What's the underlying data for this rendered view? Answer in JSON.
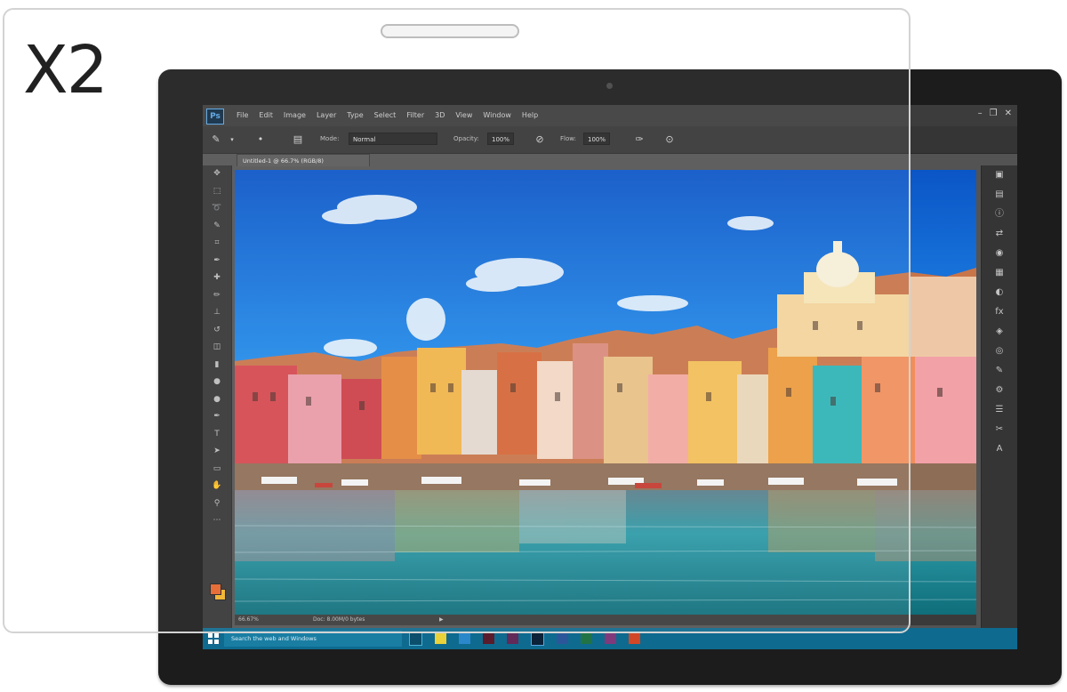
{
  "product": {
    "quantity_label": "X2"
  },
  "app": {
    "logo_text": "Ps",
    "menu": [
      "File",
      "Edit",
      "Image",
      "Layer",
      "Type",
      "Select",
      "Filter",
      "3D",
      "View",
      "Window",
      "Help"
    ],
    "options": {
      "mode_label": "Mode:",
      "mode_value": "Normal",
      "opacity_label": "Opacity:",
      "opacity_value": "100%",
      "flow_label": "Flow:",
      "flow_value": "100%"
    },
    "document_tab": "Untitled-1 @ 66.7% (RGB/8)",
    "status": {
      "zoom": "66.67%",
      "doc_info": "Doc: 8.00M/0 bytes"
    }
  },
  "taskbar": {
    "search_placeholder": "Search the web and Windows",
    "clock_time": "",
    "clock_date": ""
  },
  "colors": {
    "foreground": "#e4632b",
    "background": "#f2b129",
    "taskbar": "#0f6a8f"
  }
}
